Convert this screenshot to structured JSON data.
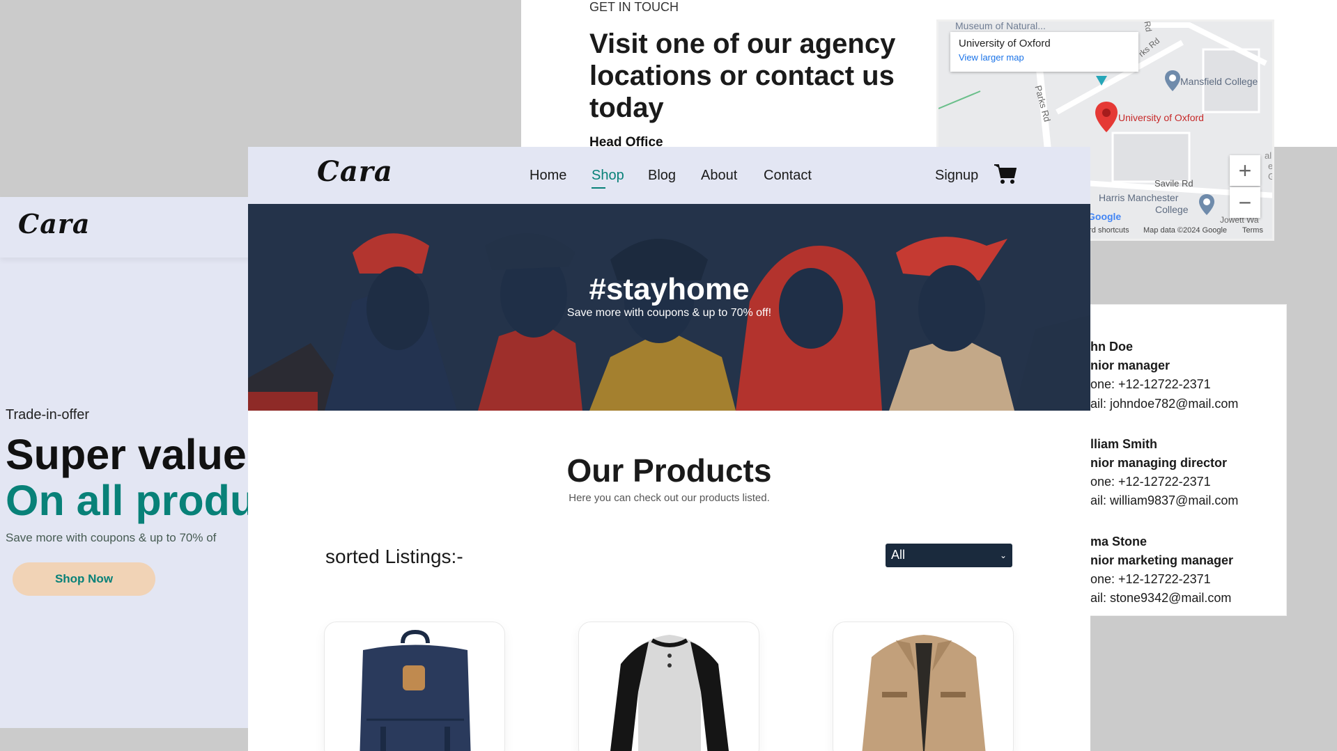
{
  "left_page": {
    "logo": "Cara",
    "trade": "Trade-in-offer",
    "headline1": "Super value",
    "headline2": "On all produ",
    "subtext": "Save more with coupons & up to 70% of",
    "cta": "Shop Now"
  },
  "contact_page": {
    "eyebrow": "GET IN TOUCH",
    "heading": "Visit one of our agency locations or contact us today",
    "head_office": "Head Office",
    "map": {
      "info_title": "University of Oxford",
      "info_link": "View larger map",
      "labels": {
        "museum": "Museum of Natural...",
        "mansfield": "Mansfield College",
        "oxford": "University of Oxford",
        "savile": "Savile Rd",
        "harris1": "Harris Manchester",
        "harris2": "College",
        "parks": "Parks Rd",
        "parks2": "rks Rd",
        "rd": "Rd",
        "jowett": "Jowett Wa",
        "google": "Google",
        "shortcuts": "ard shortcuts",
        "mapdata": "Map data ©2024 Google",
        "terms": "Terms",
        "side1": "allic",
        "side2": "ec",
        "side3": "G"
      },
      "zoom_in": "+",
      "zoom_out": "−"
    },
    "people": [
      {
        "name": "hn Doe",
        "role": "nior manager",
        "phone": "one: +12-12722-2371",
        "email": "ail: johndoe782@mail.com"
      },
      {
        "name": "lliam Smith",
        "role": "nior managing director",
        "phone": "one: +12-12722-2371",
        "email": "ail: william9837@mail.com"
      },
      {
        "name": "ma Stone",
        "role": "nior marketing manager",
        "phone": "one: +12-12722-2371",
        "email": "ail: stone9342@mail.com"
      }
    ]
  },
  "shop_page": {
    "logo": "Cara",
    "nav": [
      "Home",
      "Shop",
      "Blog",
      "About",
      "Contact"
    ],
    "active_nav": "Shop",
    "signup": "Signup",
    "hero_title": "#stayhome",
    "hero_subtitle": "Save more with coupons & up to 70% off!",
    "section_title": "Our Products",
    "section_subtitle": "Here you can check out our products listed.",
    "sorted_label": "sorted Listings:-",
    "filter_value": "All",
    "products": [
      "backpack",
      "raglan-henley-shirt",
      "khaki-jacket"
    ]
  },
  "colors": {
    "accent": "#088178",
    "nav_bg": "#e3e6f3",
    "select_bg": "#1a2a3d",
    "map_pin": "#e53935"
  }
}
